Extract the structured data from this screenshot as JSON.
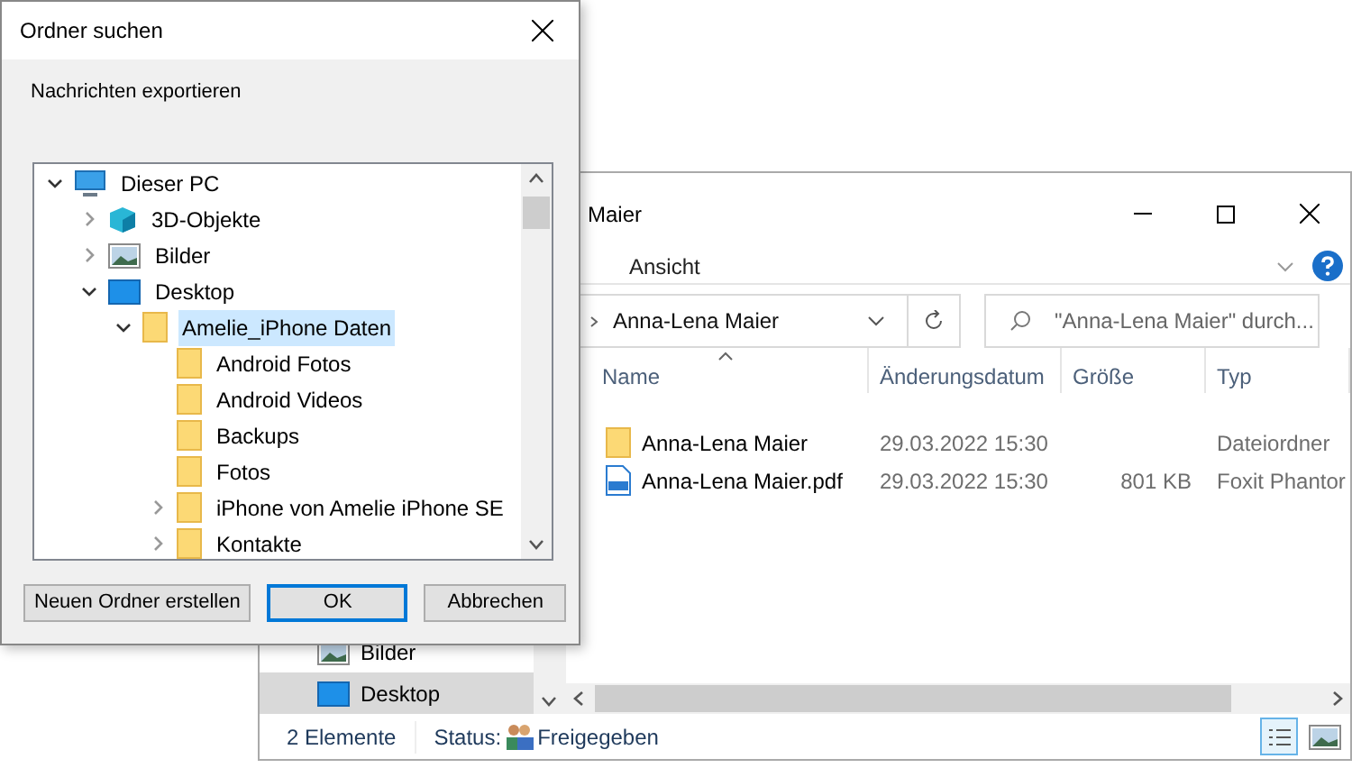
{
  "explorer": {
    "title": "Maier",
    "ribbon_tab": "Ansicht",
    "breadcrumb": "Anna-Lena Maier",
    "search": {
      "placeholder": "\"Anna-Lena Maier\" durch..."
    },
    "columns": [
      "Name",
      "Änderungsdatum",
      "Größe",
      "Typ"
    ],
    "files": [
      {
        "kind": "folder",
        "name": "Anna-Lena Maier",
        "date": "29.03.2022 15:30",
        "type": "Dateiordner"
      },
      {
        "kind": "pdf",
        "name": "Anna-Lena Maier.pdf",
        "date": "29.03.2022 15:30",
        "size": "801 KB",
        "type": "Foxit Phantor"
      }
    ],
    "nav": [
      {
        "kind": "pictures",
        "label": "Bilder",
        "selected": false
      },
      {
        "kind": "desktop",
        "label": "Desktop",
        "selected": true
      }
    ],
    "status_bar": {
      "count": "2 Elemente",
      "status_label": "Status:",
      "status_value": "Freigegeben"
    }
  },
  "dialog": {
    "title": "Ordner suchen",
    "description": "Nachrichten exportieren",
    "tree": [
      {
        "kind": "pc",
        "label": "Dieser PC",
        "expanded": true,
        "selected": false,
        "children": [
          {
            "kind": "cube",
            "label": "3D-Objekte",
            "expanded": false,
            "selected": false
          },
          {
            "kind": "pictures",
            "label": "Bilder",
            "expanded": false,
            "selected": false
          },
          {
            "kind": "desktop",
            "label": "Desktop",
            "expanded": true,
            "selected": false,
            "children": [
              {
                "kind": "folder",
                "label": "Amelie_iPhone Daten",
                "expanded": true,
                "selected": true,
                "children": [
                  {
                    "kind": "folder",
                    "label": "Android Fotos",
                    "selected": false
                  },
                  {
                    "kind": "folder",
                    "label": "Android Videos",
                    "selected": false
                  },
                  {
                    "kind": "folder",
                    "label": "Backups",
                    "selected": false
                  },
                  {
                    "kind": "folder",
                    "label": "Fotos",
                    "selected": false
                  },
                  {
                    "kind": "folder",
                    "label": "iPhone von Amelie iPhone SE",
                    "expanded": false,
                    "selected": false
                  },
                  {
                    "kind": "folder",
                    "label": "Kontakte",
                    "expanded": false,
                    "selected": false
                  }
                ]
              }
            ]
          }
        ]
      }
    ],
    "buttons": [
      {
        "label": "Neuen Ordner erstellen",
        "default": false
      },
      {
        "label": "OK",
        "default": true
      },
      {
        "label": "Abbrechen",
        "default": false
      }
    ]
  }
}
